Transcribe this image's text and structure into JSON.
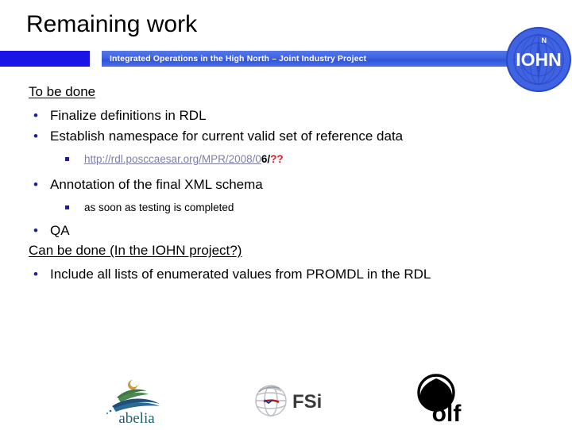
{
  "slide": {
    "title": "Remaining work",
    "header": {
      "banner_text": "Integrated Operations in the High North – Joint Industry Project",
      "logo_text": "IOHN",
      "block_color": "#1a14e6",
      "banner_color": "#3f63e2",
      "logo_color": "#3f63e2"
    },
    "body": {
      "section_1_heading": "To be done",
      "item_1": "Finalize definitions in RDL",
      "item_2": "Establish namespace for current valid set of reference data",
      "item_2_sub_link": "http://rdl.posccaesar.org/MPR/2008/0",
      "item_2_sub_tail": "6/",
      "item_2_sub_unknown": "??",
      "item_3": "Annotation of the final XML schema",
      "item_3_sub": "as soon as testing is completed",
      "item_4": "QA",
      "section_2_heading": "Can be done (In the IOHN project?)",
      "item_5": "Include all lists of enumerated values from PROMDL in the RDL",
      "bullet_marker": "•",
      "link_color": "#7e7ea8",
      "unknown_color": "#d81f24",
      "bullet_color": "#1f1f8f"
    },
    "footer": {
      "logos": [
        {
          "name": "abelia",
          "label": "abelia",
          "color": "#1f5f6e"
        },
        {
          "name": "fsi",
          "label": "FSi",
          "color": "#3a3a3a"
        },
        {
          "name": "olf",
          "label": "olf",
          "color": "#000000"
        }
      ]
    }
  }
}
